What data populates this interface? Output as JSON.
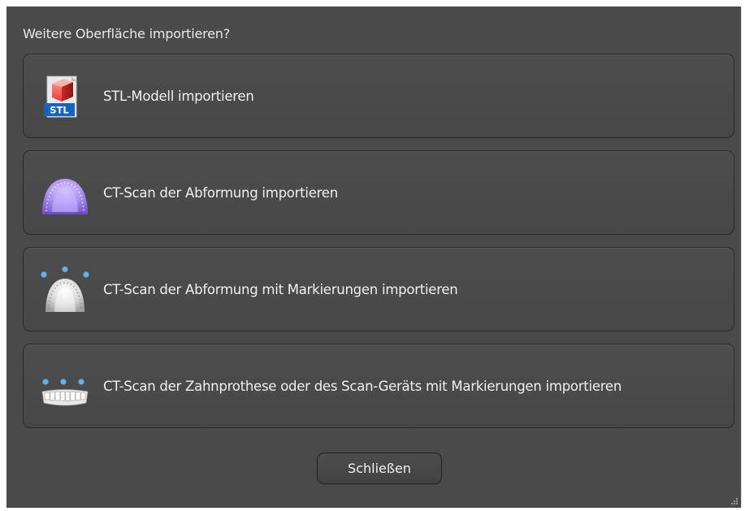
{
  "dialog": {
    "prompt": "Weitere Oberfläche importieren?",
    "options": [
      {
        "label": "STL-Modell importieren",
        "icon": "stl-file-icon"
      },
      {
        "label": "CT-Scan der Abformung importieren",
        "icon": "impression-icon"
      },
      {
        "label": "CT-Scan der Abformung mit Markierungen importieren",
        "icon": "impression-markers-icon"
      },
      {
        "label": "CT-Scan der Zahnprothese oder des Scan-Geräts mit Markierungen importieren",
        "icon": "denture-markers-icon"
      }
    ],
    "stl_badge": "STL",
    "close_label": "Schließen"
  },
  "colors": {
    "background": "#4a4a4a",
    "impression_purple": "#9b7fe0",
    "marker_blue": "#5fb0f0"
  }
}
